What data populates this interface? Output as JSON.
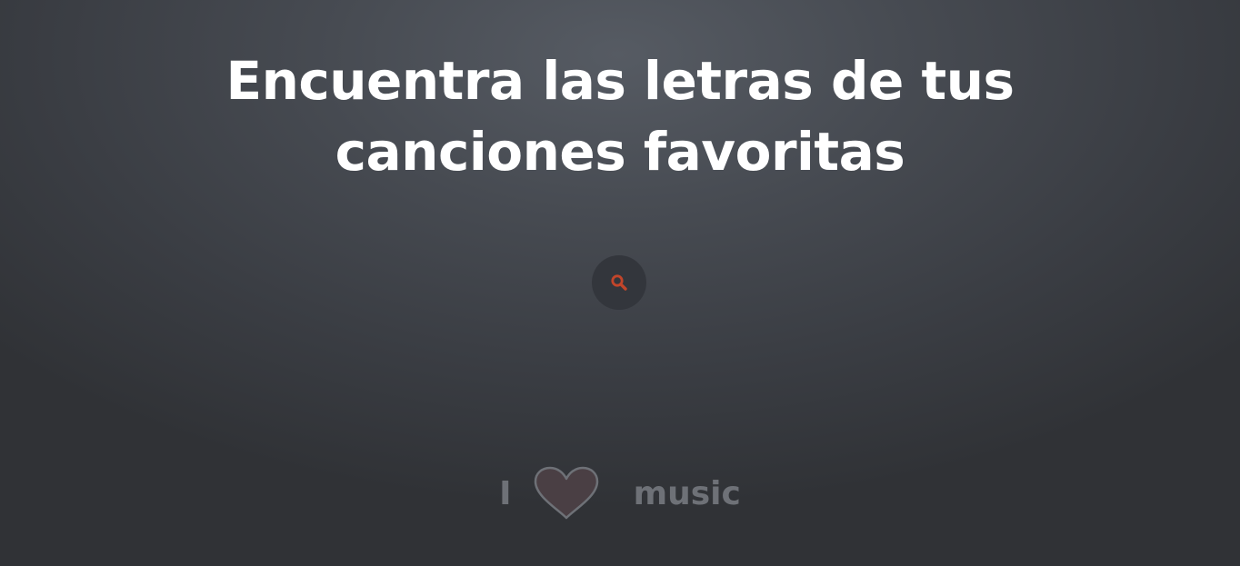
{
  "hero": {
    "title": "Encuentra las letras de tus canciones favoritas"
  },
  "search": {
    "icon": "search-icon",
    "icon_color": "#c2452a",
    "button_color": "#33363c"
  },
  "brand": {
    "prefix": "I",
    "heart_icon": "heart-icon",
    "suffix": "music"
  }
}
